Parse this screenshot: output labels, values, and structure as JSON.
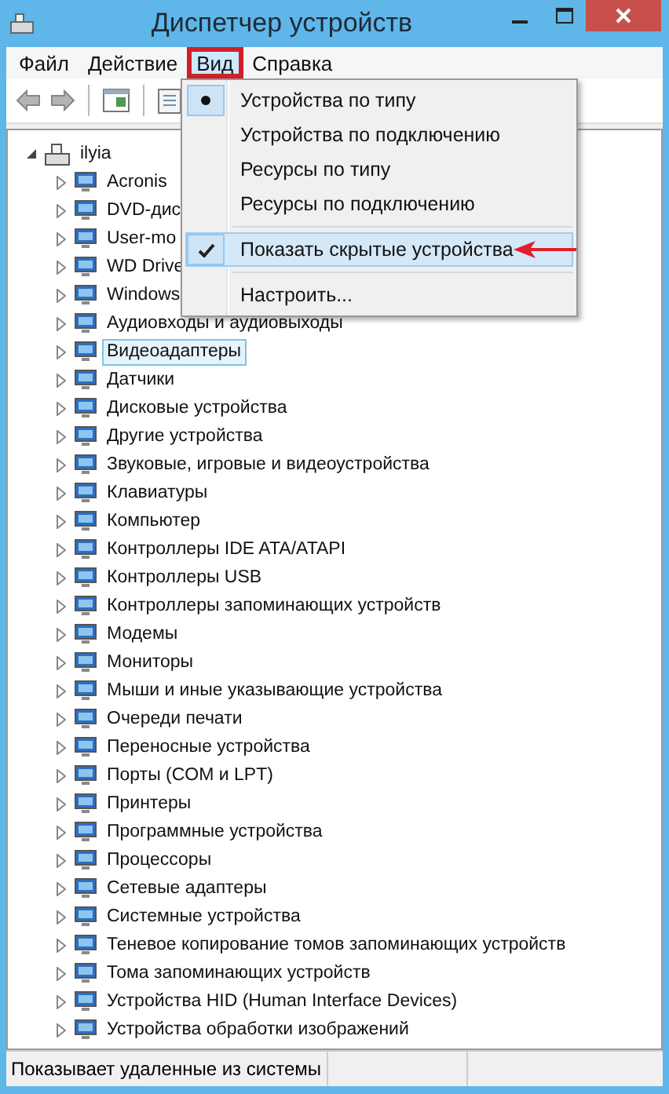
{
  "window": {
    "title": "Диспетчер устройств"
  },
  "menu_bar": [
    {
      "label": "Файл",
      "selected": false
    },
    {
      "label": "Действие",
      "selected": false
    },
    {
      "label": "Вид",
      "selected": true
    },
    {
      "label": "Справка",
      "selected": false
    }
  ],
  "view_menu": {
    "items": [
      {
        "kind": "radio",
        "label": "Устройства по типу",
        "checked": true,
        "highlighted": false
      },
      {
        "kind": "radio",
        "label": "Устройства по подключению",
        "checked": false,
        "highlighted": false
      },
      {
        "kind": "radio",
        "label": "Ресурсы по типу",
        "checked": false,
        "highlighted": false
      },
      {
        "kind": "radio",
        "label": "Ресурсы по подключению",
        "checked": false,
        "highlighted": false
      },
      {
        "kind": "separator"
      },
      {
        "kind": "check",
        "label": "Показать скрытые устройства",
        "checked": true,
        "highlighted": true
      },
      {
        "kind": "separator"
      },
      {
        "kind": "command",
        "label": "Настроить..."
      }
    ]
  },
  "device_tree": {
    "root": {
      "label": "ilyia",
      "expanded": true,
      "selected": false,
      "children": [
        {
          "label": "Acronis",
          "expanded": false,
          "selected": false
        },
        {
          "label": "DVD-дис",
          "expanded": false,
          "selected": false
        },
        {
          "label": "User-mo",
          "expanded": false,
          "selected": false
        },
        {
          "label": "WD Drive",
          "expanded": false,
          "selected": false
        },
        {
          "label": "Windows",
          "expanded": false,
          "selected": false
        },
        {
          "label": "Аудиовходы и аудиовыходы",
          "expanded": false,
          "selected": false
        },
        {
          "label": "Видеоадаптеры",
          "expanded": false,
          "selected": true
        },
        {
          "label": "Датчики",
          "expanded": false,
          "selected": false
        },
        {
          "label": "Дисковые устройства",
          "expanded": false,
          "selected": false
        },
        {
          "label": "Другие устройства",
          "expanded": false,
          "selected": false
        },
        {
          "label": "Звуковые, игровые и видеоустройства",
          "expanded": false,
          "selected": false
        },
        {
          "label": "Клавиатуры",
          "expanded": false,
          "selected": false
        },
        {
          "label": "Компьютер",
          "expanded": false,
          "selected": false
        },
        {
          "label": "Контроллеры IDE ATA/ATAPI",
          "expanded": false,
          "selected": false
        },
        {
          "label": "Контроллеры USB",
          "expanded": false,
          "selected": false
        },
        {
          "label": "Контроллеры запоминающих устройств",
          "expanded": false,
          "selected": false
        },
        {
          "label": "Модемы",
          "expanded": false,
          "selected": false
        },
        {
          "label": "Мониторы",
          "expanded": false,
          "selected": false
        },
        {
          "label": "Мыши и иные указывающие устройства",
          "expanded": false,
          "selected": false
        },
        {
          "label": "Очереди печати",
          "expanded": false,
          "selected": false
        },
        {
          "label": "Переносные устройства",
          "expanded": false,
          "selected": false
        },
        {
          "label": "Порты (COM и LPT)",
          "expanded": false,
          "selected": false
        },
        {
          "label": "Принтеры",
          "expanded": false,
          "selected": false
        },
        {
          "label": "Программные устройства",
          "expanded": false,
          "selected": false
        },
        {
          "label": "Процессоры",
          "expanded": false,
          "selected": false
        },
        {
          "label": "Сетевые адаптеры",
          "expanded": false,
          "selected": false
        },
        {
          "label": "Системные устройства",
          "expanded": false,
          "selected": false
        },
        {
          "label": "Теневое копирование томов запоминающих устройств",
          "expanded": false,
          "selected": false
        },
        {
          "label": "Тома запоминающих устройств",
          "expanded": false,
          "selected": false
        },
        {
          "label": "Устройства HID (Human Interface Devices)",
          "expanded": false,
          "selected": false
        },
        {
          "label": "Устройства обработки изображений",
          "expanded": false,
          "selected": false
        }
      ]
    }
  },
  "status_bar": {
    "text": "Показывает удаленные из системы"
  }
}
